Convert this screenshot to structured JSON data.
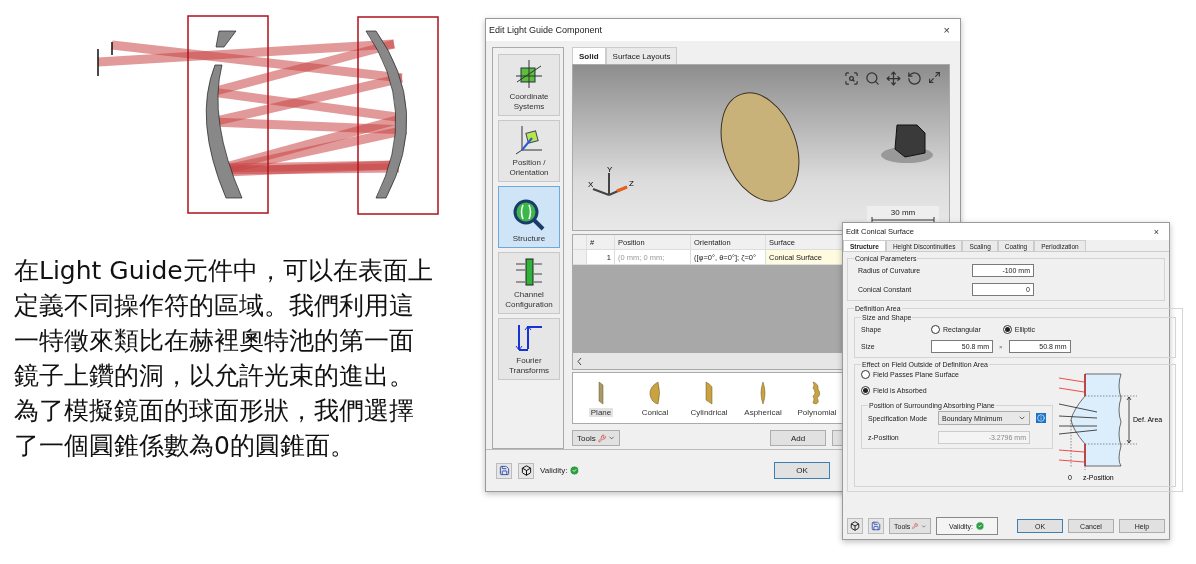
{
  "caption": "在Light Guide元件中，可以在表面上定義不同操作符的區域。我們利用這一特徵來類比在赫裡奧特池的第一面鏡子上鑽的洞，以允許光束的進出。為了模擬鏡面的球面形狀，我們選擇了一個圓錐係數為0的圓錐面。",
  "main_dialog": {
    "title": "Edit Light Guide Component",
    "close": "×",
    "nav": [
      {
        "kind": "coordinates",
        "label": "Coordinate Systems",
        "selected": false
      },
      {
        "kind": "position",
        "label": "Position / Orientation",
        "selected": false
      },
      {
        "kind": "structure",
        "label": "Structure",
        "selected": true
      },
      {
        "kind": "channel",
        "label": "Channel Configuration",
        "selected": false
      },
      {
        "kind": "fourier",
        "label": "Fourier Transforms",
        "selected": false
      }
    ],
    "tabs": [
      {
        "label": "Solid",
        "selected": true
      },
      {
        "label": "Surface Layouts",
        "selected": false
      }
    ],
    "viewport": {
      "axes": [
        "X",
        "Y",
        "Z"
      ],
      "scale": "30 mm"
    },
    "table": {
      "columns": [
        "#",
        "Position",
        "Orientation",
        "Surface"
      ],
      "rows": [
        {
          "cells": [
            "1",
            "(0 mm; 0 mm;",
            "([φ=0°, θ=0°]; ζ=0°",
            "Conical Surface"
          ]
        }
      ]
    },
    "surfaces": [
      {
        "kind": "plane",
        "label": "Plane",
        "selected": true
      },
      {
        "kind": "conical",
        "label": "Conical",
        "selected": false
      },
      {
        "kind": "cylindrical",
        "label": "Cylindrical",
        "selected": false
      },
      {
        "kind": "aspherical",
        "label": "Aspherical",
        "selected": false
      },
      {
        "kind": "polynomial",
        "label": "Polynomial",
        "selected": false
      }
    ],
    "tools": "Tools",
    "add": "Add",
    "validity": "Validity:",
    "ok": "OK"
  },
  "conical_dialog": {
    "title": "Edit Conical Surface",
    "close": "×",
    "tabs": [
      {
        "label": "Structure",
        "selected": true
      },
      {
        "label": "Height Discontinuities",
        "selected": false
      },
      {
        "label": "Scaling",
        "selected": false
      },
      {
        "label": "Coating",
        "selected": false
      },
      {
        "label": "Periodization",
        "selected": false
      }
    ],
    "conical_parameters": {
      "title": "Conical Parameters",
      "fields": [
        {
          "label": "Radius of Curvature",
          "value": "-100 mm"
        },
        {
          "label": "Conical Constant",
          "value": "0"
        }
      ]
    },
    "definition_area": {
      "title": "Definition Area",
      "size_and_shape": {
        "title": "Size and Shape",
        "shape_label": "Shape",
        "options": [
          {
            "label": "Rectangular",
            "selected": false
          },
          {
            "label": "Elliptic",
            "selected": true
          }
        ],
        "size_label": "Size",
        "size_values": [
          "50.8 mm",
          "50.8 mm"
        ],
        "times": "×"
      },
      "effect": {
        "title": "Effect on Field Outside of Definition Area",
        "options": [
          {
            "label": "Field Passes Plane Surface",
            "selected": false
          },
          {
            "label": "Field is Absorbed",
            "selected": true
          }
        ],
        "absorbing_plane": {
          "title": "Position of Surrounding Absorbing Plane",
          "mode_label": "Specification Mode",
          "mode_value": "Boundary Minimum",
          "z_label": "z-Position",
          "z_value": "-3.2796 mm"
        },
        "figure": {
          "area_label": "Def. Area",
          "zero_label": "0",
          "z_label": "z-Position"
        }
      }
    },
    "tools": "Tools",
    "validity": "Validity:",
    "buttons": [
      "OK",
      "Cancel",
      "Help"
    ]
  }
}
